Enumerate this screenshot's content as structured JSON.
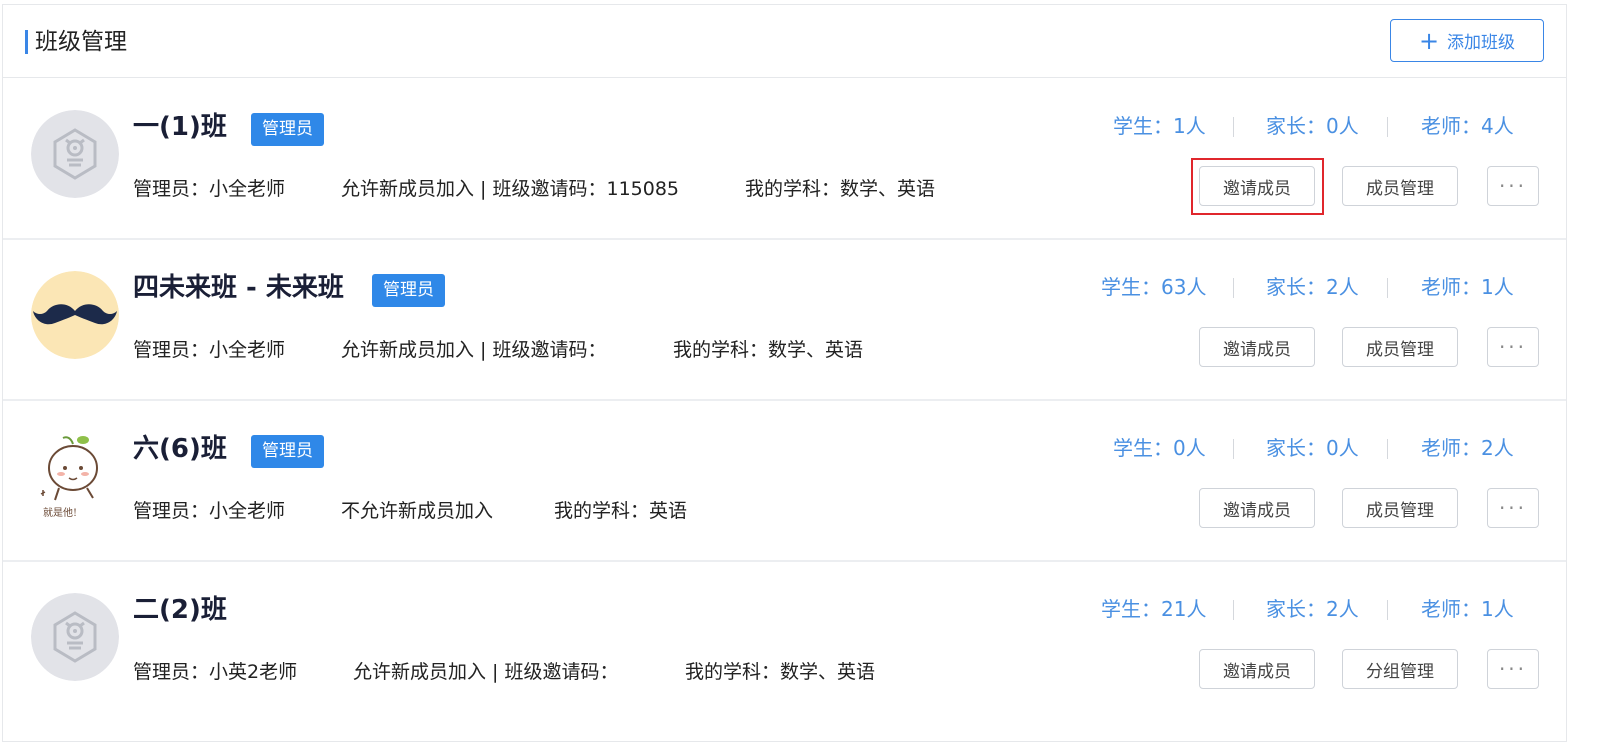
{
  "header": {
    "title": "班级管理",
    "add_button": "添加班级",
    "add_icon": "+"
  },
  "accent_color": "#3a86e6",
  "classes": [
    {
      "name": "一(1)班",
      "role": "管理员",
      "admin": "管理员：小全老师",
      "join": "允许新成员加入 | 班级邀请码：115085",
      "subjects": "我的学科：数学、英语",
      "students": "学生：1人",
      "parents": "家长：0人",
      "teachers": "老师：4人",
      "btn1": "邀请成员",
      "btn2": "成员管理",
      "more": "···",
      "avatar": "hex-robot-avatar"
    },
    {
      "name": "四未来班 - 未来班",
      "role": "管理员",
      "admin": "管理员：小全老师",
      "join": "允许新成员加入 | 班级邀请码：",
      "subjects": "我的学科：数学、英语",
      "students": "学生：63人",
      "parents": "家长：2人",
      "teachers": "老师：1人",
      "btn1": "邀请成员",
      "btn2": "成员管理",
      "more": "···",
      "avatar": "mustache-avatar"
    },
    {
      "name": "六(6)班",
      "role": "管理员",
      "admin": "管理员：小全老师",
      "join": "不允许新成员加入",
      "subjects": "我的学科：英语",
      "students": "学生：0人",
      "parents": "家长：0人",
      "teachers": "老师：2人",
      "btn1": "邀请成员",
      "btn2": "成员管理",
      "more": "···",
      "avatar": "sprout-character-avatar",
      "avatar_caption": "就是他!"
    },
    {
      "name": "二(2)班",
      "admin": "管理员：小英2老师",
      "join": "允许新成员加入 | 班级邀请码：",
      "subjects": "我的学科：数学、英语",
      "students": "学生：21人",
      "parents": "家长：2人",
      "teachers": "老师：1人",
      "btn1": "邀请成员",
      "btn2": "分组管理",
      "more": "···",
      "avatar": "hex-robot-avatar"
    }
  ]
}
